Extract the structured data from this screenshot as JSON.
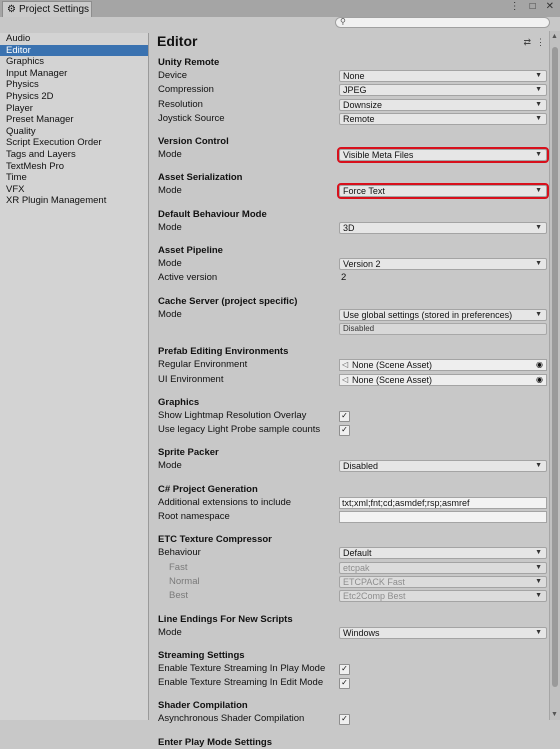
{
  "window": {
    "tab_title": "Project Settings"
  },
  "sidebar": {
    "items": [
      "Audio",
      "Editor",
      "Graphics",
      "Input Manager",
      "Physics",
      "Physics 2D",
      "Player",
      "Preset Manager",
      "Quality",
      "Script Execution Order",
      "Tags and Layers",
      "TextMesh Pro",
      "Time",
      "VFX",
      "XR Plugin Management"
    ],
    "selected": "Editor"
  },
  "page": {
    "title": "Editor"
  },
  "sections": {
    "unity_remote": {
      "header": "Unity Remote",
      "device": {
        "label": "Device",
        "value": "None"
      },
      "compression": {
        "label": "Compression",
        "value": "JPEG"
      },
      "resolution": {
        "label": "Resolution",
        "value": "Downsize"
      },
      "joystick": {
        "label": "Joystick Source",
        "value": "Remote"
      }
    },
    "version_control": {
      "header": "Version Control",
      "mode": {
        "label": "Mode",
        "value": "Visible Meta Files"
      }
    },
    "asset_serialization": {
      "header": "Asset Serialization",
      "mode": {
        "label": "Mode",
        "value": "Force Text"
      }
    },
    "default_behaviour": {
      "header": "Default Behaviour Mode",
      "mode": {
        "label": "Mode",
        "value": "3D"
      }
    },
    "asset_pipeline": {
      "header": "Asset Pipeline",
      "mode": {
        "label": "Mode",
        "value": "Version 2"
      },
      "active": {
        "label": "Active version",
        "value": "2"
      }
    },
    "cache_server": {
      "header": "Cache Server (project specific)",
      "mode": {
        "label": "Mode",
        "value": "Use global settings (stored in preferences)"
      },
      "status": "Disabled"
    },
    "prefab": {
      "header": "Prefab Editing Environments",
      "regular": {
        "label": "Regular Environment",
        "value": "None (Scene Asset)"
      },
      "ui": {
        "label": "UI Environment",
        "value": "None (Scene Asset)"
      }
    },
    "graphics": {
      "header": "Graphics",
      "overlay": {
        "label": "Show Lightmap Resolution Overlay",
        "checked": true
      },
      "legacy": {
        "label": "Use legacy Light Probe sample counts",
        "checked": true
      }
    },
    "sprite_packer": {
      "header": "Sprite Packer",
      "mode": {
        "label": "Mode",
        "value": "Disabled"
      }
    },
    "csharp": {
      "header": "C# Project Generation",
      "extensions": {
        "label": "Additional extensions to include",
        "value": "txt;xml;fnt;cd;asmdef;rsp;asmref"
      },
      "namespace": {
        "label": "Root namespace",
        "value": ""
      }
    },
    "etc": {
      "header": "ETC Texture Compressor",
      "behaviour": {
        "label": "Behaviour",
        "value": "Default"
      },
      "fast": {
        "label": "Fast",
        "value": "etcpak"
      },
      "normal": {
        "label": "Normal",
        "value": "ETCPACK Fast"
      },
      "best": {
        "label": "Best",
        "value": "Etc2Comp Best"
      }
    },
    "line_endings": {
      "header": "Line Endings For New Scripts",
      "mode": {
        "label": "Mode",
        "value": "Windows"
      }
    },
    "streaming": {
      "header": "Streaming Settings",
      "play": {
        "label": "Enable Texture Streaming In Play Mode",
        "checked": true
      },
      "edit": {
        "label": "Enable Texture Streaming In Edit Mode",
        "checked": true
      }
    },
    "shader": {
      "header": "Shader Compilation",
      "async": {
        "label": "Asynchronous Shader Compilation",
        "checked": true
      }
    },
    "enter_play": {
      "header": "Enter Play Mode Settings"
    }
  },
  "icons": {
    "tab": "gear-icon",
    "search": "search-icon",
    "check": "✓",
    "dropdown": "▼"
  },
  "colors": {
    "selection": "#3a72b0",
    "highlight": "#d8101c"
  }
}
